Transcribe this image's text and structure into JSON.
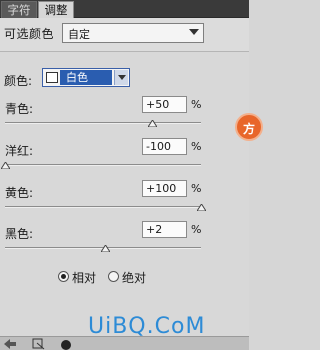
{
  "tabs": [
    {
      "label": "字符"
    },
    {
      "label": "调整"
    }
  ],
  "preset": {
    "label": "可选颜色",
    "value": "自定"
  },
  "colors": {
    "label": "颜色:",
    "value": "白色"
  },
  "sliders": [
    {
      "label": "青色:",
      "value": "+50",
      "unit": "%",
      "level": 0.75
    },
    {
      "label": "洋红:",
      "value": "-100",
      "unit": "%",
      "level": 0.0
    },
    {
      "label": "黄色:",
      "value": "+100",
      "unit": "%",
      "level": 1.0
    },
    {
      "label": "黑色:",
      "value": "+2",
      "unit": "%",
      "level": 0.51
    }
  ],
  "method": {
    "options": [
      {
        "label": "相对",
        "checked": true
      },
      {
        "label": "绝对",
        "checked": false
      }
    ]
  },
  "side_badge": {
    "text": "方"
  },
  "watermark": "UiBQ.CoM"
}
